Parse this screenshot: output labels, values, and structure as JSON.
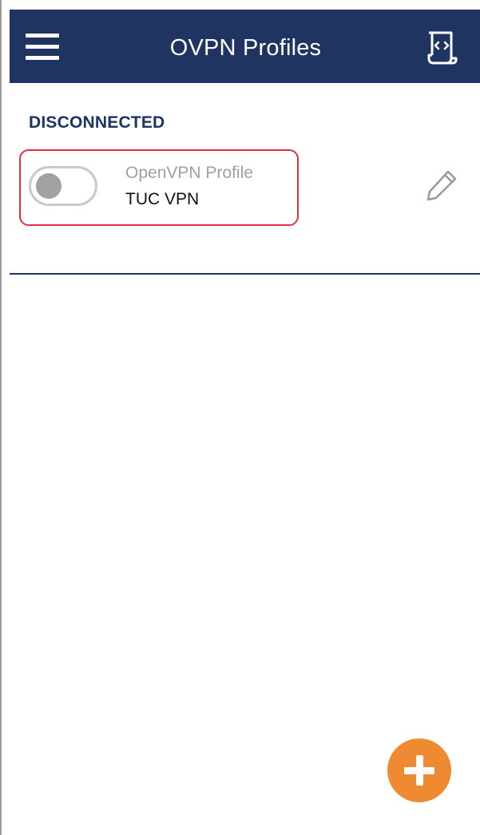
{
  "app_bar": {
    "title": "OVPN Profiles",
    "menu_icon": "hamburger-menu-icon",
    "import_icon": "import-profile-icon"
  },
  "status": {
    "label": "DISCONNECTED"
  },
  "profiles": [
    {
      "type_label": "OpenVPN Profile",
      "name": "TUC VPN",
      "connected": false,
      "edit_icon": "pencil-icon"
    }
  ],
  "fab": {
    "icon": "plus-icon"
  },
  "colors": {
    "header": "#1f3460",
    "accent": "#ee8a32",
    "highlight_border": "#e0303f",
    "secondary_text": "#a0a0a0"
  }
}
